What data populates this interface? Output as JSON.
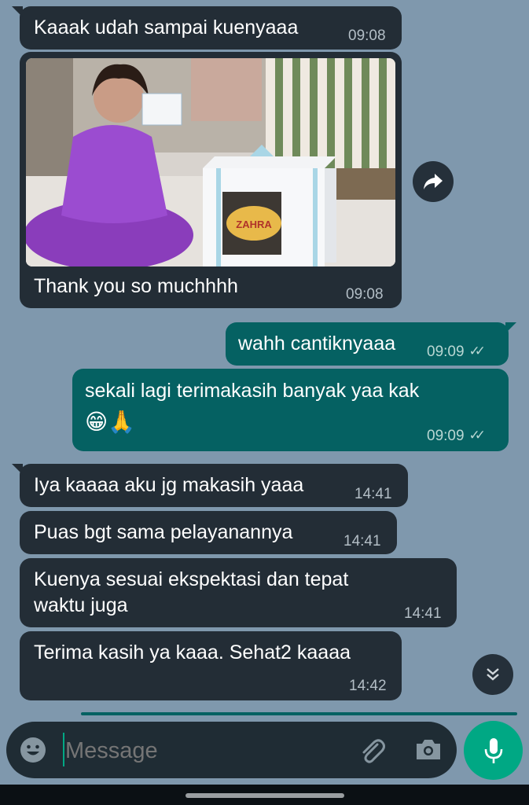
{
  "messages": [
    {
      "text": "Kaaak udah sampai kuenyaaa",
      "time": "09:08"
    },
    {
      "caption": "Thank you so muchhhh",
      "time": "09:08"
    },
    {
      "text": "wahh cantiknyaaa",
      "time": "09:09",
      "status": "✓✓"
    },
    {
      "text": "sekali lagi terimakasih banyak yaa kak",
      "emoji": "😁🙏",
      "time": "09:09",
      "status": "✓✓"
    },
    {
      "text": "Iya kaaaa aku jg makasih yaaa",
      "time": "14:41"
    },
    {
      "text": "Puas bgt sama pelayanannya",
      "time": "14:41"
    },
    {
      "text": "Kuenya sesuai ekspektasi dan tepat\nwaktu juga",
      "time": "14:41"
    },
    {
      "text": "Terima kasih ya kaaa. Sehat2 kaaaa",
      "time": "14:42"
    }
  ],
  "photo": {
    "cake_label": "ZAHRA"
  },
  "composer": {
    "placeholder": "Message"
  },
  "icons": {
    "forward": "forward-arrow-icon",
    "scroll": "double-chevron-down-icon",
    "emoji": "emoji-icon",
    "attach": "paperclip-icon",
    "camera": "camera-icon",
    "mic": "microphone-icon"
  },
  "colors": {
    "background": "#7f98ad",
    "incoming_bubble": "#232d36",
    "outgoing_bubble": "#056162",
    "accent": "#00a884"
  }
}
